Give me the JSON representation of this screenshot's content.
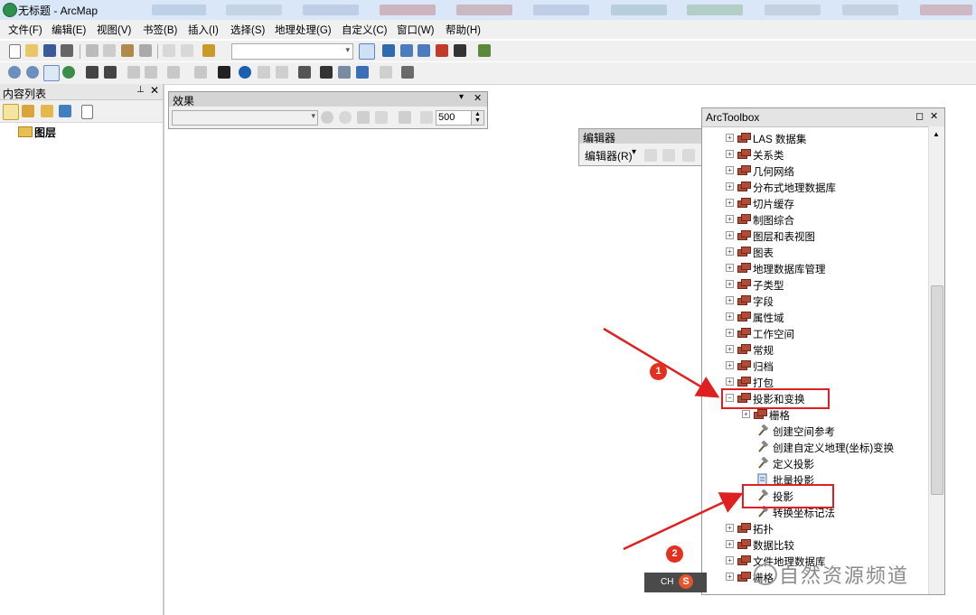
{
  "window": {
    "title": "无标题 - ArcMap"
  },
  "menu": [
    "文件(F)",
    "编辑(E)",
    "视图(V)",
    "书签(B)",
    "插入(I)",
    "选择(S)",
    "地理处理(G)",
    "自定义(C)",
    "窗口(W)",
    "帮助(H)"
  ],
  "toc": {
    "title": "内容列表",
    "root_label": "图层"
  },
  "effects": {
    "title": "效果",
    "value": "500"
  },
  "editor": {
    "title": "编辑器",
    "menu_label": "编辑器(R)"
  },
  "toolbox": {
    "title": "ArcToolbox",
    "items": [
      {
        "label": "LAS 数据集",
        "kind": "toolbox",
        "expanded": false
      },
      {
        "label": "关系类",
        "kind": "toolbox",
        "expanded": false
      },
      {
        "label": "几何网络",
        "kind": "toolbox",
        "expanded": false
      },
      {
        "label": "分布式地理数据库",
        "kind": "toolbox",
        "expanded": false
      },
      {
        "label": "切片缓存",
        "kind": "toolbox",
        "expanded": false
      },
      {
        "label": "制图综合",
        "kind": "toolbox",
        "expanded": false
      },
      {
        "label": "图层和表视图",
        "kind": "toolbox",
        "expanded": false
      },
      {
        "label": "图表",
        "kind": "toolbox",
        "expanded": false
      },
      {
        "label": "地理数据库管理",
        "kind": "toolbox",
        "expanded": false
      },
      {
        "label": "子类型",
        "kind": "toolbox",
        "expanded": false
      },
      {
        "label": "字段",
        "kind": "toolbox",
        "expanded": false
      },
      {
        "label": "属性域",
        "kind": "toolbox",
        "expanded": false
      },
      {
        "label": "工作空间",
        "kind": "toolbox",
        "expanded": false
      },
      {
        "label": "常规",
        "kind": "toolbox",
        "expanded": false
      },
      {
        "label": "归档",
        "kind": "toolbox",
        "expanded": false
      },
      {
        "label": "打包",
        "kind": "toolbox",
        "expanded": false
      },
      {
        "label": "投影和变换",
        "kind": "toolbox",
        "expanded": true
      },
      {
        "label": "栅格",
        "kind": "sub-toolbox",
        "expanded": false
      },
      {
        "label": "创建空间参考",
        "kind": "tool"
      },
      {
        "label": "创建自定义地理(坐标)变换",
        "kind": "tool"
      },
      {
        "label": "定义投影",
        "kind": "tool"
      },
      {
        "label": "批量投影",
        "kind": "script"
      },
      {
        "label": "投影",
        "kind": "tool"
      },
      {
        "label": "转换坐标记法",
        "kind": "tool"
      },
      {
        "label": "拓扑",
        "kind": "toolbox",
        "expanded": false
      },
      {
        "label": "数据比较",
        "kind": "toolbox",
        "expanded": false
      },
      {
        "label": "文件地理数据库",
        "kind": "toolbox",
        "expanded": false
      },
      {
        "label": "栅格",
        "kind": "toolbox",
        "expanded": false
      }
    ]
  },
  "annotations": {
    "badge1": "1",
    "badge2": "2"
  },
  "ime": {
    "label": "CH"
  },
  "watermark": {
    "text": "自然资源频道"
  },
  "colors": {
    "highlight": "#e02020",
    "toolbox_icon": "#b34a36"
  }
}
